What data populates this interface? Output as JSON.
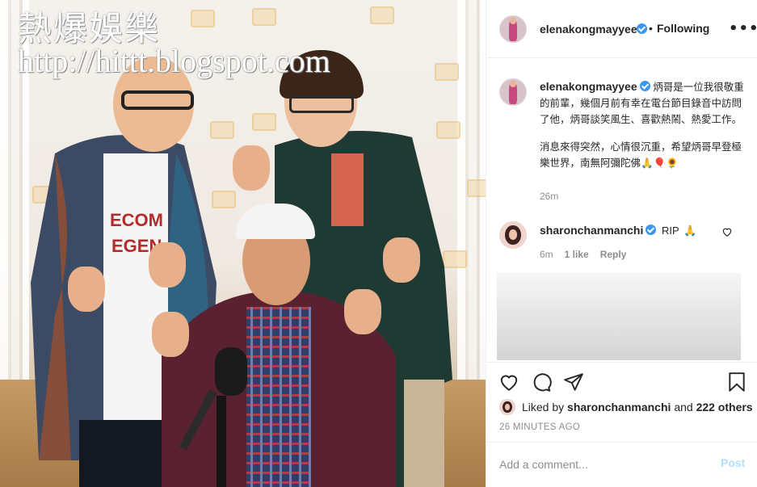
{
  "watermark": {
    "title": "熱爆娛樂",
    "url": "http://hittt.blogspot.com"
  },
  "post": {
    "author": "elenakongmayyee",
    "verified": true,
    "follow_separator": "•",
    "follow_label": "Following",
    "more_icon": "more-horizontal-icon",
    "caption_username": "elenakongmayyee",
    "caption_paragraph_1": "炳哥是一位我很敬重的前輩，幾個月前有幸在電台節目錄音中訪問了他，炳哥談笑風生、喜歡熱鬧、熱愛工作。",
    "caption_paragraph_2": "消息來得突然，心情很沉重，希望炳哥早登極樂世界，南無阿彌陀佛🙏🎈🌻",
    "caption_time": "26m"
  },
  "comment": {
    "username": "sharonchanmanchi",
    "verified": true,
    "text": "RIP",
    "emoji": "🙏",
    "time": "6m",
    "likes": "1 like",
    "reply_label": "Reply"
  },
  "actions": {
    "icons": [
      "heart-icon",
      "comment-icon",
      "share-icon",
      "bookmark-icon"
    ]
  },
  "likes_summary": {
    "prefix": "Liked by",
    "user": "sharonchanmanchi",
    "middle": "and",
    "others": "222 others"
  },
  "posted_time": "26 MINUTES AGO",
  "add_comment": {
    "placeholder": "Add a comment...",
    "post_label": "Post"
  },
  "colors": {
    "verified_blue": "#3897f0",
    "post_button_disabled": "#b2dffc",
    "secondary_text": "#8e8e8e",
    "primary_text": "#262626"
  }
}
